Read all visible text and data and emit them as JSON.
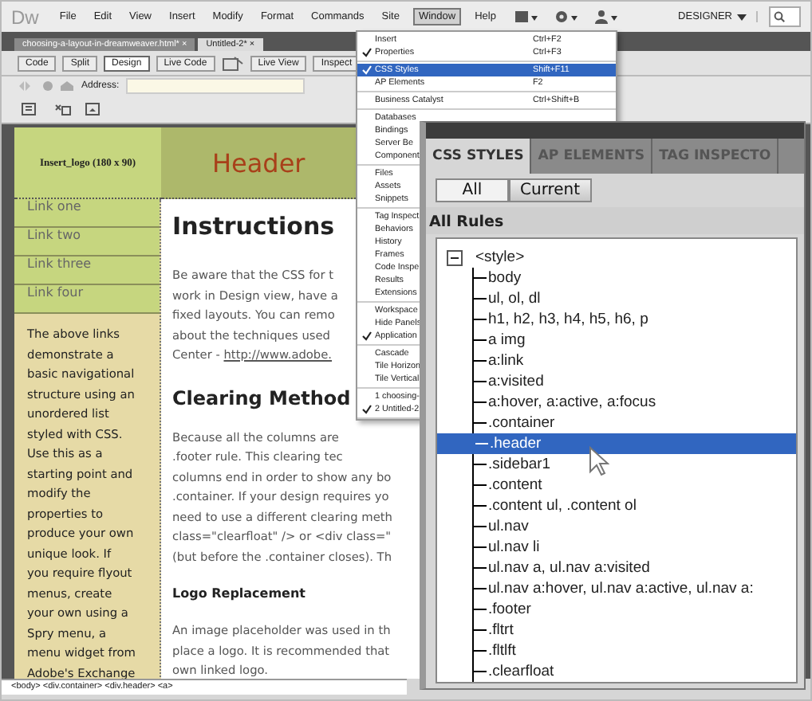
{
  "app": {
    "logo": "Dw",
    "menus": [
      {
        "label": "File",
        "selected": false
      },
      {
        "label": "Edit",
        "selected": false
      },
      {
        "label": "View",
        "selected": false
      },
      {
        "label": "Insert",
        "selected": false
      },
      {
        "label": "Modify",
        "selected": false
      },
      {
        "label": "Format",
        "selected": false
      },
      {
        "label": "Commands",
        "selected": false
      },
      {
        "label": "Site",
        "selected": false
      },
      {
        "label": "Window",
        "selected": true
      },
      {
        "label": "Help",
        "selected": false
      }
    ],
    "workspace": "DESIGNER"
  },
  "doc_tabs": [
    {
      "label": "choosing-a-layout-in-dreamweaver.html*",
      "close": "×",
      "selected": false
    },
    {
      "label": "Untitled-2*",
      "close": "×",
      "selected": true
    }
  ],
  "view_buttons": [
    {
      "label": "Code",
      "selected": false
    },
    {
      "label": "Split",
      "selected": false
    },
    {
      "label": "Design",
      "selected": true
    }
  ],
  "toolbar_buttons": [
    "Live Code",
    "Live View",
    "Inspect"
  ],
  "address_label": "Address:",
  "page": {
    "logo_placeholder": "Insert_logo (180 x 90)",
    "header": "Header",
    "nav_links": [
      "Link one",
      "Link two",
      "Link three",
      "Link four"
    ],
    "sidebar_text": "The above links\ndemonstrate a\nbasic navigational\nstructure using an\nunordered list\nstyled with CSS.\nUse this as a\nstarting point and\nmodify the\nproperties to\nproduce your own\nunique look. If\nyou require flyout\nmenus, create\nyour own using a\nSpry menu, a\nmenu widget from\nAdobe's Exchange",
    "heading": "Instructions",
    "intro": {
      "text": "Be aware that the CSS for t\nwork in Design view, have a\nfixed layouts. You can remo\nabout the techniques used\nCenter - ",
      "link": "http://www.adobe."
    },
    "clearing_heading": "Clearing Method",
    "clearing_text": "Because all the columns are\n.footer rule. This clearing tec\ncolumns end in order to show any bo\n.container. If your design requires yo\nneed to use a different clearing meth\nclass=\"clearfloat\" /> or <div class=\"\n(but before the .container closes). Th",
    "logo_heading": "Logo Replacement",
    "logo_text": "An image placeholder was used in th\nplace a logo. It is recommended that\nown linked logo."
  },
  "status_bar": "<body> <div.container> <div.header> <a>",
  "window_menu": [
    [
      {
        "label": "Insert",
        "shortcut": "Ctrl+F2",
        "checked": false,
        "selected": false
      },
      {
        "label": "Properties",
        "shortcut": "Ctrl+F3",
        "checked": true,
        "selected": false
      }
    ],
    [
      {
        "label": "CSS Styles",
        "shortcut": "Shift+F11",
        "checked": true,
        "selected": true
      },
      {
        "label": "AP Elements",
        "shortcut": "F2",
        "checked": false,
        "selected": false
      }
    ],
    [
      {
        "label": "Business Catalyst",
        "shortcut": "Ctrl+Shift+B",
        "checked": false,
        "selected": false
      }
    ],
    [
      {
        "label": "Databases",
        "checked": false,
        "selected": false
      },
      {
        "label": "Bindings",
        "checked": false,
        "selected": false
      },
      {
        "label": "Server Be",
        "checked": false,
        "selected": false
      },
      {
        "label": "Component",
        "checked": false,
        "selected": false
      }
    ],
    [
      {
        "label": "Files",
        "checked": false,
        "selected": false
      },
      {
        "label": "Assets",
        "checked": false,
        "selected": false
      },
      {
        "label": "Snippets",
        "checked": false,
        "selected": false
      }
    ],
    [
      {
        "label": "Tag Inspect",
        "checked": false,
        "selected": false
      },
      {
        "label": "Behaviors",
        "checked": false,
        "selected": false
      },
      {
        "label": "History",
        "checked": false,
        "selected": false
      },
      {
        "label": "Frames",
        "checked": false,
        "selected": false
      },
      {
        "label": "Code Inspe",
        "checked": false,
        "selected": false
      },
      {
        "label": "Results",
        "checked": false,
        "selected": false
      },
      {
        "label": "Extensions",
        "checked": false,
        "selected": false
      }
    ],
    [
      {
        "label": "Workspace",
        "checked": false,
        "selected": false
      },
      {
        "label": "Hide Panels",
        "checked": false,
        "selected": false
      },
      {
        "label": "Application",
        "checked": true,
        "selected": false
      }
    ],
    [
      {
        "label": "Cascade",
        "checked": false,
        "selected": false
      },
      {
        "label": "Tile Horizon",
        "checked": false,
        "selected": false
      },
      {
        "label": "Tile Vertical",
        "checked": false,
        "selected": false
      }
    ],
    [
      {
        "label": "1 choosing-",
        "checked": false,
        "selected": false
      },
      {
        "label": "2 Untitled-2",
        "checked": true,
        "selected": false
      }
    ]
  ],
  "css_panel": {
    "tabs": [
      {
        "label": "CSS STYLES",
        "selected": true
      },
      {
        "label": "AP ELEMENTS",
        "selected": false
      },
      {
        "label": "TAG INSPECTO",
        "selected": false
      }
    ],
    "toggle": [
      {
        "label": "All",
        "selected": true
      },
      {
        "label": "Current",
        "selected": false
      }
    ],
    "section": "All Rules",
    "tree": {
      "label": "<style>",
      "expanded": true,
      "children": [
        {
          "label": "body",
          "selected": false
        },
        {
          "label": "ul, ol, dl",
          "selected": false
        },
        {
          "label": "h1, h2, h3, h4, h5, h6, p",
          "selected": false
        },
        {
          "label": "a img",
          "selected": false
        },
        {
          "label": "a:link",
          "selected": false
        },
        {
          "label": "a:visited",
          "selected": false
        },
        {
          "label": "a:hover, a:active, a:focus",
          "selected": false
        },
        {
          "label": ".container",
          "selected": false
        },
        {
          "label": ".header",
          "selected": true
        },
        {
          "label": ".sidebar1",
          "selected": false
        },
        {
          "label": ".content",
          "selected": false
        },
        {
          "label": ".content ul, .content ol",
          "selected": false
        },
        {
          "label": "ul.nav",
          "selected": false
        },
        {
          "label": "ul.nav li",
          "selected": false
        },
        {
          "label": "ul.nav a, ul.nav a:visited",
          "selected": false
        },
        {
          "label": "ul.nav a:hover, ul.nav a:active, ul.nav a:",
          "selected": false
        },
        {
          "label": ".footer",
          "selected": false
        },
        {
          "label": ".fltrt",
          "selected": false
        },
        {
          "label": ".fltlft",
          "selected": false
        },
        {
          "label": ".clearfloat",
          "selected": false
        }
      ]
    }
  }
}
